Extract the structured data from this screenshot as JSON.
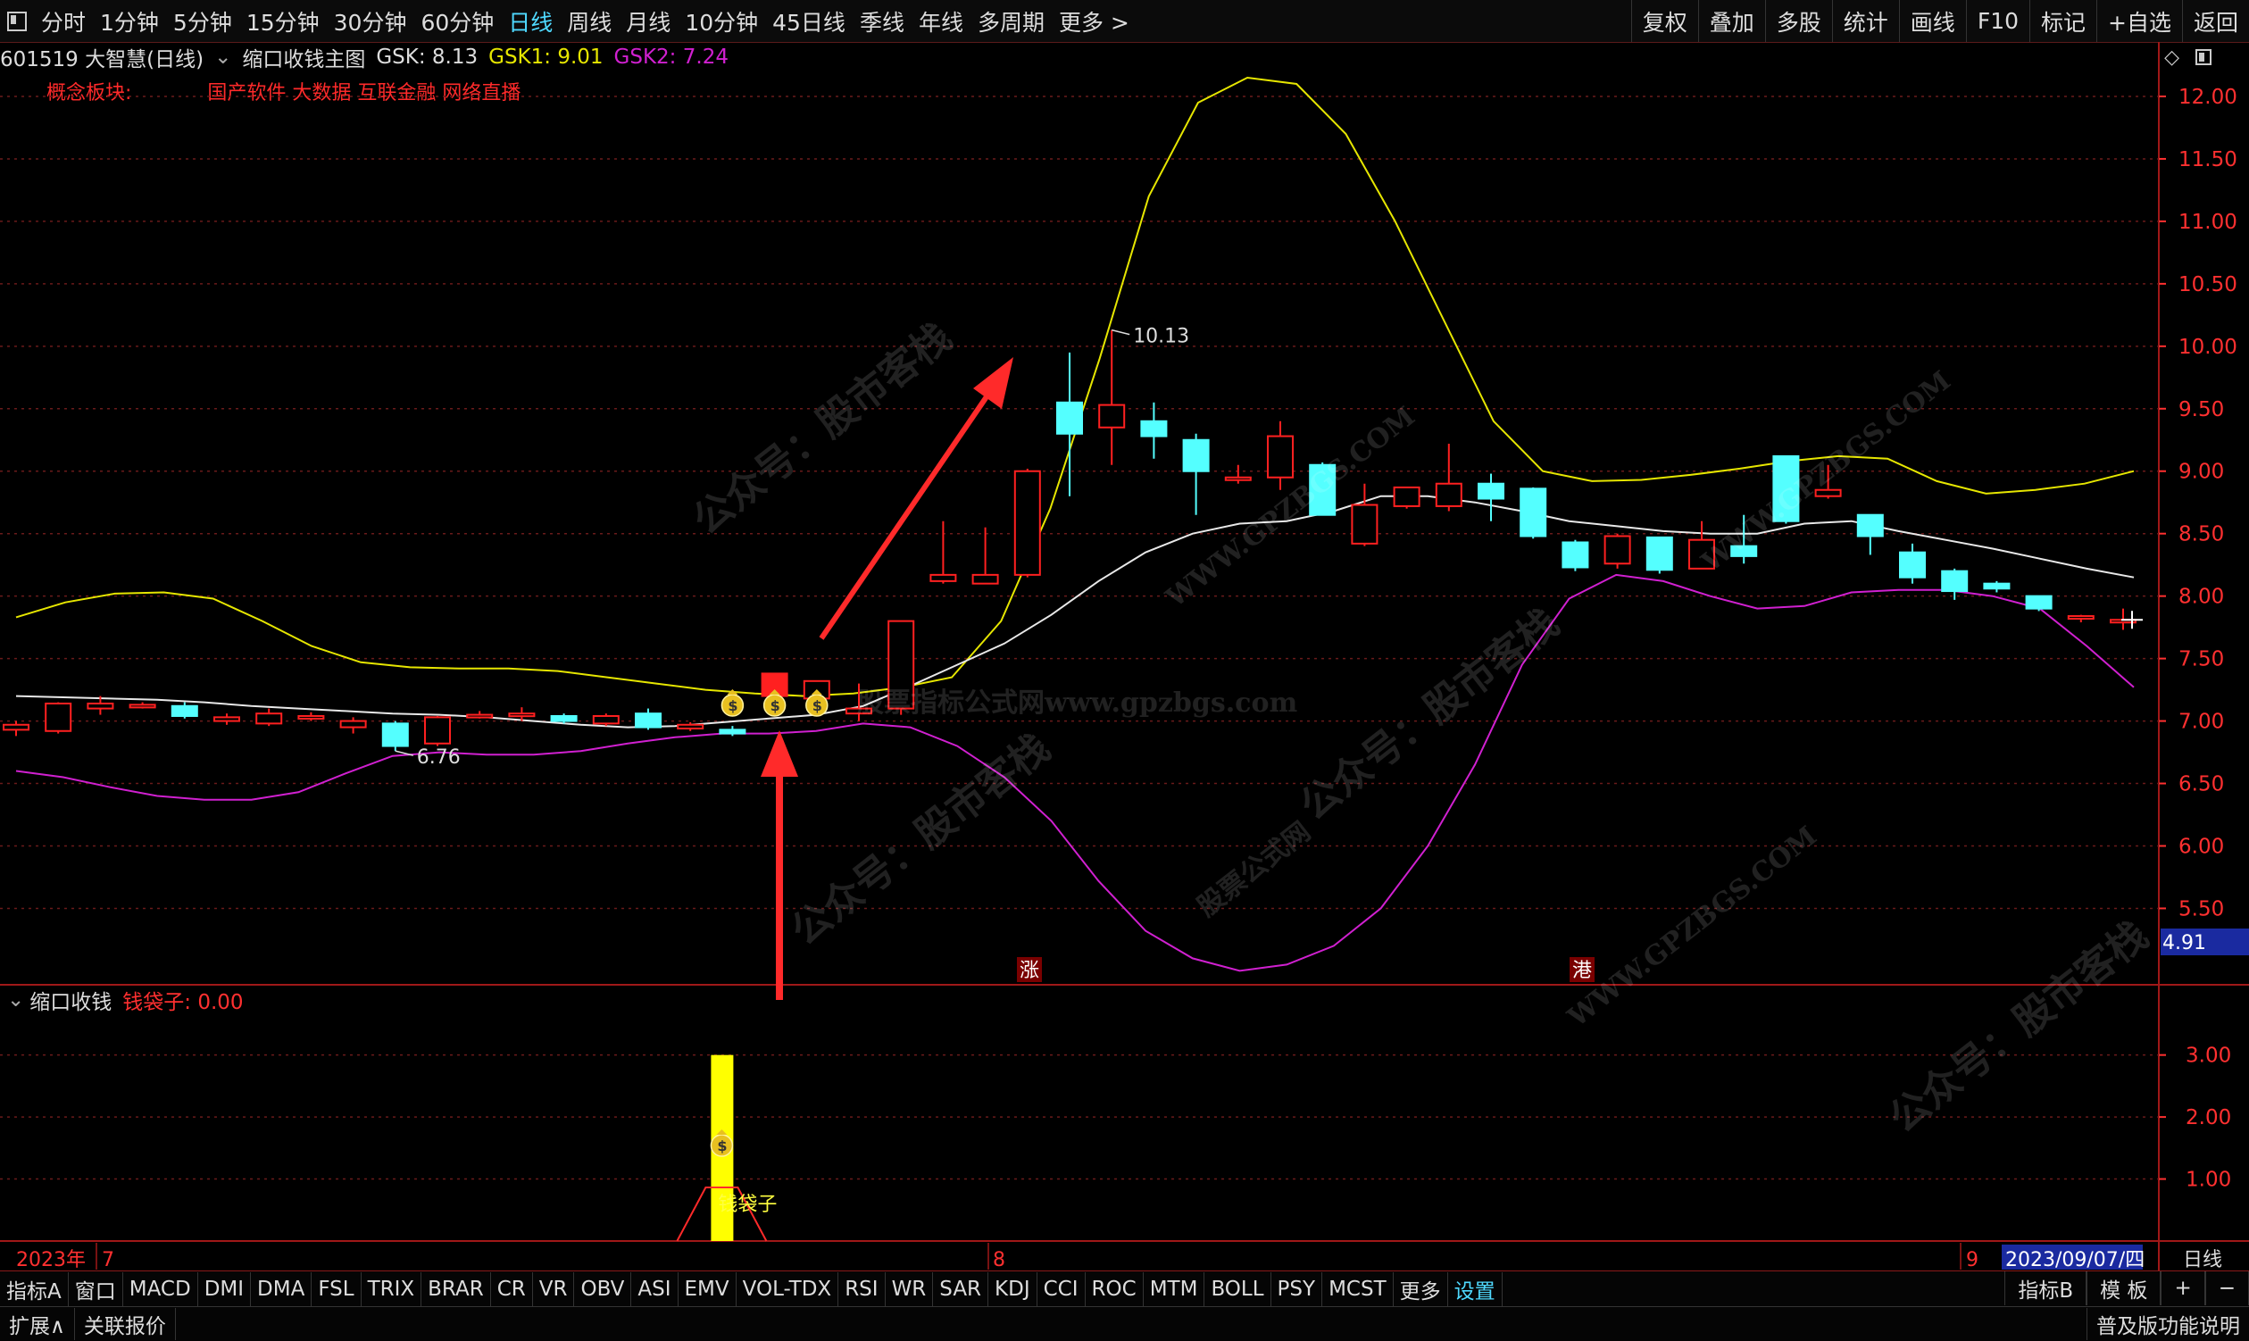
{
  "topbar": {
    "periods": [
      "分时",
      "1分钟",
      "5分钟",
      "15分钟",
      "30分钟",
      "60分钟",
      "日线",
      "周线",
      "月线",
      "10分钟",
      "45日线",
      "季线",
      "年线",
      "多周期",
      "更多 >"
    ],
    "active_period": "日线",
    "right_buttons": [
      "复权",
      "叠加",
      "多股",
      "统计",
      "画线",
      "F10",
      "标记",
      "+自选",
      "返回"
    ]
  },
  "info": {
    "stock": "601519 大智慧(日线)",
    "indicator": "缩口收钱主图",
    "gsk": "GSK: 8.13",
    "gsk1": "GSK1: 9.01",
    "gsk2": "GSK2: 7.24"
  },
  "concept": {
    "label": "概念板块:",
    "tags": "国产软件 大数据 互联金融 网络直播"
  },
  "price_axis": {
    "labels": [
      "12.00",
      "11.50",
      "11.00",
      "10.50",
      "10.00",
      "9.50",
      "9.00",
      "8.50",
      "8.00",
      "7.50",
      "7.00",
      "6.50",
      "6.00",
      "5.50"
    ],
    "current_box": "4.91"
  },
  "annotations": {
    "high_label": "10.13",
    "low_label": "6.76",
    "marker_zhang": "涨",
    "marker_gang": "港"
  },
  "sub_panel": {
    "title": "缩口收钱",
    "series_label": "钱袋子: 0.00",
    "axis_labels": [
      "3.00",
      "2.00",
      "1.00"
    ],
    "bar_label": "钱袋子"
  },
  "date_axis": {
    "year": "2023年",
    "m7": "7",
    "m8": "8",
    "m9": "9",
    "current_date": "2023/09/07/四",
    "period": "日线"
  },
  "watermarks": {
    "w1": "公众号：股市客栈",
    "w2": "WWW.GPZBGS.COM",
    "w3": "股票指标公式网www.gpzbgs.com",
    "w4": "股票公式网"
  },
  "bottom_indicators": [
    "指标A",
    "窗口",
    "MACD",
    "DMI",
    "DMA",
    "FSL",
    "TRIX",
    "BRAR",
    "CR",
    "VR",
    "OBV",
    "ASI",
    "EMV",
    "VOL-TDX",
    "RSI",
    "WR",
    "SAR",
    "KDJ",
    "CCI",
    "ROC",
    "MTM",
    "BOLL",
    "PSY",
    "MCST",
    "更多",
    "设置"
  ],
  "bottom_right": [
    "指标B",
    "模 板",
    "+",
    "−"
  ],
  "bottom_bar2": {
    "left": [
      "扩展∧",
      "关联报价"
    ],
    "right": "普及版功能说明"
  },
  "colors": {
    "up": "#ff2020",
    "down": "#54ffff",
    "upper_band": "#e6e600",
    "mid_band": "#e8e8e8",
    "lower_band": "#d020d0",
    "grid": "#6a1a1a",
    "money_bar": "#ffff00"
  },
  "chart_data": {
    "type": "candlestick",
    "price_range": [
      4.91,
      12.2
    ],
    "candles": [
      {
        "o": 6.93,
        "c": 6.97,
        "h": 7.0,
        "l": 6.88
      },
      {
        "o": 6.92,
        "c": 7.14,
        "h": 7.15,
        "l": 6.9
      },
      {
        "o": 7.1,
        "c": 7.14,
        "h": 7.2,
        "l": 7.05
      },
      {
        "o": 7.12,
        "c": 7.13,
        "h": 7.15,
        "l": 7.1
      },
      {
        "o": 7.12,
        "c": 7.04,
        "h": 7.15,
        "l": 7.02
      },
      {
        "o": 7.0,
        "c": 7.03,
        "h": 7.06,
        "l": 6.97
      },
      {
        "o": 6.98,
        "c": 7.06,
        "h": 7.1,
        "l": 6.96
      },
      {
        "o": 7.04,
        "c": 7.04,
        "h": 7.07,
        "l": 7.0
      },
      {
        "o": 6.95,
        "c": 7.0,
        "h": 7.03,
        "l": 6.9
      },
      {
        "o": 6.98,
        "c": 6.8,
        "h": 7.0,
        "l": 6.76
      },
      {
        "o": 6.82,
        "c": 7.03,
        "h": 7.04,
        "l": 6.8
      },
      {
        "o": 7.03,
        "c": 7.05,
        "h": 7.08,
        "l": 7.02
      },
      {
        "o": 7.06,
        "c": 7.06,
        "h": 7.11,
        "l": 7.0
      },
      {
        "o": 7.04,
        "c": 7.0,
        "h": 7.06,
        "l": 6.98
      },
      {
        "o": 6.98,
        "c": 7.04,
        "h": 7.06,
        "l": 6.96
      },
      {
        "o": 7.06,
        "c": 6.95,
        "h": 7.1,
        "l": 6.93
      },
      {
        "o": 6.94,
        "c": 6.97,
        "h": 6.99,
        "l": 6.92
      },
      {
        "o": 6.93,
        "c": 6.9,
        "h": 6.96,
        "l": 6.88
      },
      {
        "o": 7.2,
        "c": 7.38,
        "h": 7.38,
        "l": 7.2
      },
      {
        "o": 7.18,
        "c": 7.32,
        "h": 7.32,
        "l": 7.18
      },
      {
        "o": 7.06,
        "c": 7.1,
        "h": 7.3,
        "l": 7.0
      },
      {
        "o": 7.1,
        "c": 7.8,
        "h": 7.8,
        "l": 7.05
      },
      {
        "o": 8.12,
        "c": 8.17,
        "h": 8.6,
        "l": 8.1
      },
      {
        "o": 8.1,
        "c": 8.17,
        "h": 8.55,
        "l": 8.1
      },
      {
        "o": 8.17,
        "c": 9.0,
        "h": 9.02,
        "l": 8.15
      },
      {
        "o": 9.55,
        "c": 9.3,
        "h": 9.95,
        "l": 8.8
      },
      {
        "o": 9.35,
        "c": 9.53,
        "h": 10.13,
        "l": 9.05
      },
      {
        "o": 9.4,
        "c": 9.28,
        "h": 9.55,
        "l": 9.1
      },
      {
        "o": 9.25,
        "c": 9.0,
        "h": 9.3,
        "l": 8.65
      },
      {
        "o": 8.95,
        "c": 8.95,
        "h": 9.05,
        "l": 8.9
      },
      {
        "o": 8.95,
        "c": 9.28,
        "h": 9.4,
        "l": 8.85
      },
      {
        "o": 9.05,
        "c": 8.65,
        "h": 9.07,
        "l": 8.65
      },
      {
        "o": 8.42,
        "c": 8.73,
        "h": 8.9,
        "l": 8.4
      },
      {
        "o": 8.72,
        "c": 8.87,
        "h": 8.87,
        "l": 8.7
      },
      {
        "o": 8.72,
        "c": 8.9,
        "h": 9.22,
        "l": 8.68
      },
      {
        "o": 8.9,
        "c": 8.78,
        "h": 8.98,
        "l": 8.6
      },
      {
        "o": 8.86,
        "c": 8.48,
        "h": 8.87,
        "l": 8.46
      },
      {
        "o": 8.43,
        "c": 8.23,
        "h": 8.45,
        "l": 8.2
      },
      {
        "o": 8.26,
        "c": 8.48,
        "h": 8.5,
        "l": 8.22
      },
      {
        "o": 8.47,
        "c": 8.21,
        "h": 8.47,
        "l": 8.18
      },
      {
        "o": 8.22,
        "c": 8.45,
        "h": 8.6,
        "l": 8.22
      },
      {
        "o": 8.4,
        "c": 8.32,
        "h": 8.65,
        "l": 8.26
      },
      {
        "o": 9.12,
        "c": 8.6,
        "h": 9.12,
        "l": 8.58
      },
      {
        "o": 8.8,
        "c": 8.85,
        "h": 9.05,
        "l": 8.78
      },
      {
        "o": 8.65,
        "c": 8.48,
        "h": 8.65,
        "l": 8.33
      },
      {
        "o": 8.35,
        "c": 8.15,
        "h": 8.42,
        "l": 8.1
      },
      {
        "o": 8.2,
        "c": 8.04,
        "h": 8.22,
        "l": 7.97
      },
      {
        "o": 8.1,
        "c": 8.06,
        "h": 8.12,
        "l": 8.03
      },
      {
        "o": 8.0,
        "c": 7.9,
        "h": 8.0,
        "l": 7.88
      },
      {
        "o": 7.82,
        "c": 7.84,
        "h": 7.85,
        "l": 7.79
      },
      {
        "o": 7.81,
        "c": 7.81,
        "h": 7.9,
        "l": 7.73
      }
    ],
    "upper_band": [
      7.83,
      7.95,
      8.02,
      8.03,
      7.98,
      7.8,
      7.6,
      7.47,
      7.43,
      7.42,
      7.42,
      7.4,
      7.35,
      7.3,
      7.25,
      7.22,
      7.2,
      7.22,
      7.27,
      7.35,
      7.8,
      8.7,
      9.9,
      11.2,
      11.95,
      12.15,
      12.1,
      11.7,
      11.0,
      10.2,
      9.4,
      9.0,
      8.92,
      8.93,
      8.97,
      9.02,
      9.08,
      9.12,
      9.1,
      8.92,
      8.82,
      8.85,
      8.9,
      9.0
    ],
    "mid_band": [
      7.2,
      7.19,
      7.18,
      7.17,
      7.15,
      7.12,
      7.1,
      7.08,
      7.06,
      7.05,
      7.03,
      7.0,
      6.97,
      6.95,
      6.96,
      6.99,
      7.02,
      7.05,
      7.12,
      7.28,
      7.45,
      7.62,
      7.85,
      8.12,
      8.35,
      8.5,
      8.58,
      8.6,
      8.68,
      8.8,
      8.8,
      8.75,
      8.68,
      8.6,
      8.56,
      8.52,
      8.5,
      8.5,
      8.58,
      8.6,
      8.52,
      8.45,
      8.38,
      8.3,
      8.22,
      8.15
    ],
    "lower_band": [
      6.6,
      6.55,
      6.47,
      6.4,
      6.37,
      6.37,
      6.43,
      6.58,
      6.72,
      6.75,
      6.73,
      6.73,
      6.76,
      6.82,
      6.87,
      6.9,
      6.9,
      6.92,
      6.98,
      6.95,
      6.8,
      6.55,
      6.2,
      5.72,
      5.32,
      5.1,
      5.0,
      5.05,
      5.2,
      5.5,
      6.0,
      6.65,
      7.45,
      7.98,
      8.17,
      8.12,
      8.0,
      7.9,
      7.92,
      8.03,
      8.05,
      8.05,
      8.0,
      7.9,
      7.6,
      7.27
    ],
    "money_signal": {
      "candle_index": 17,
      "value": 3.0
    },
    "money_icons_at": [
      17,
      18,
      19
    ]
  }
}
